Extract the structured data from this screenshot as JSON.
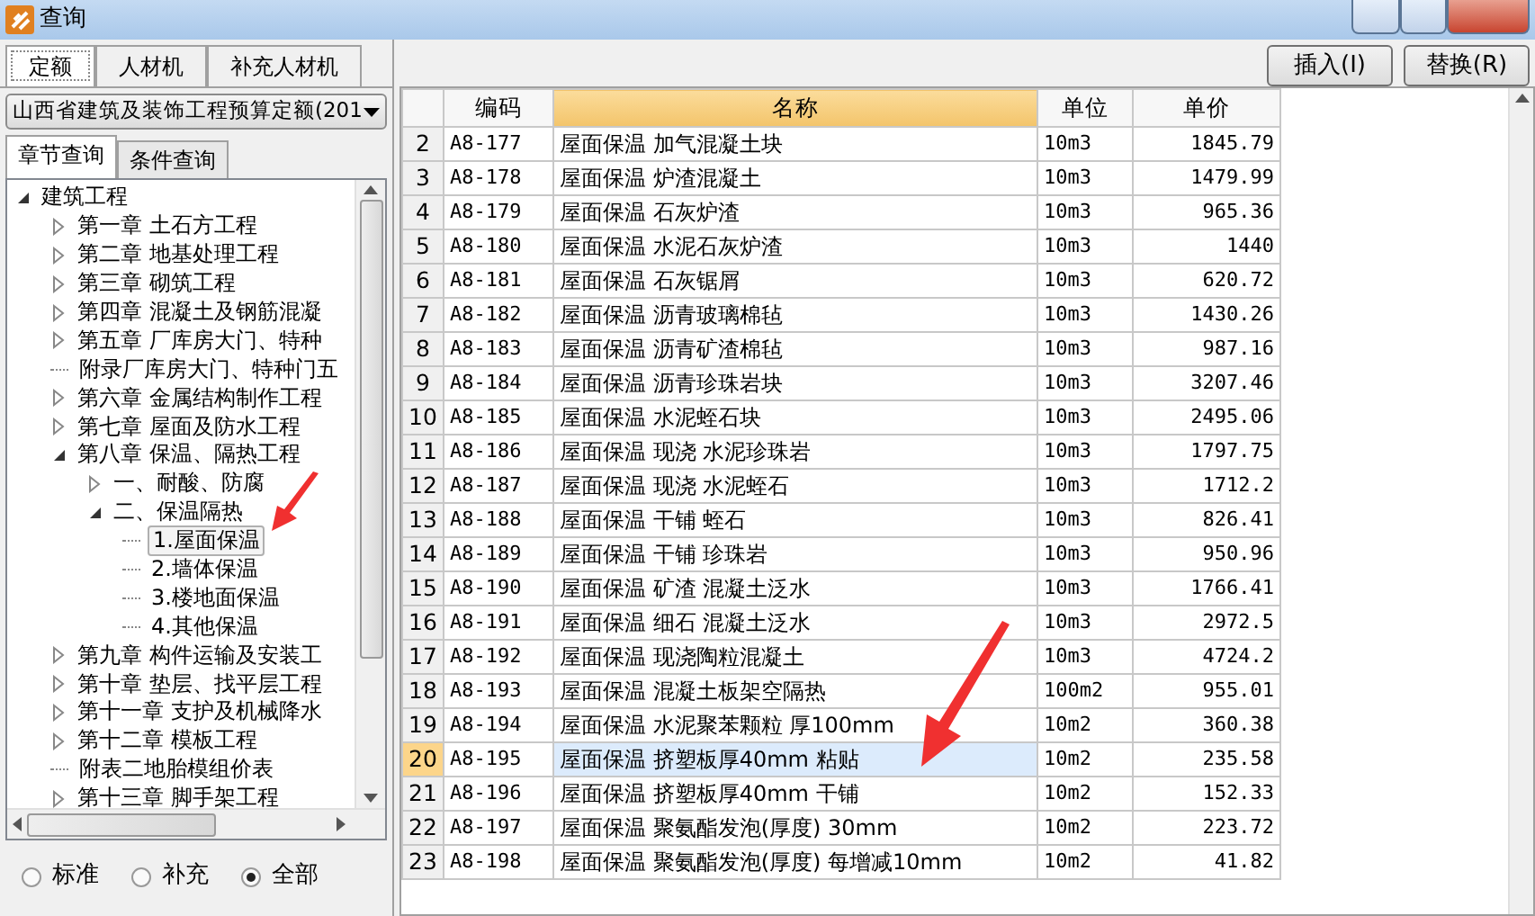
{
  "window": {
    "title": "查询"
  },
  "top_tabs": [
    {
      "label": "定额",
      "selected": true
    },
    {
      "label": "人材机",
      "selected": false
    },
    {
      "label": "补充人材机",
      "selected": false
    }
  ],
  "quota_select": {
    "value": "山西省建筑及装饰工程预算定额(201"
  },
  "query_tabs": [
    {
      "label": "章节查询",
      "selected": true
    },
    {
      "label": "条件查询",
      "selected": false
    }
  ],
  "tree": [
    {
      "label": "建筑工程",
      "expanded": true,
      "selected": false,
      "children": [
        {
          "label": "第一章 土石方工程",
          "expanded": false,
          "selected": false
        },
        {
          "label": "第二章 地基处理工程",
          "expanded": false,
          "selected": false
        },
        {
          "label": "第三章 砌筑工程",
          "expanded": false,
          "selected": false
        },
        {
          "label": "第四章 混凝土及钢筋混凝",
          "expanded": false,
          "selected": false
        },
        {
          "label": "第五章 厂库房大门、特种",
          "expanded": false,
          "selected": false
        },
        {
          "label": "附录厂库房大门、特种门五",
          "selected": false
        },
        {
          "label": "第六章 金属结构制作工程",
          "expanded": false,
          "selected": false
        },
        {
          "label": "第七章 屋面及防水工程",
          "expanded": false,
          "selected": false
        },
        {
          "label": "第八章 保温、隔热工程",
          "expanded": true,
          "selected": false,
          "children": [
            {
              "label": "一、耐酸、防腐",
              "expanded": false,
              "selected": false
            },
            {
              "label": "二、保温隔热",
              "expanded": true,
              "selected": false,
              "children": [
                {
                  "label": "1.屋面保温",
                  "selected": true
                },
                {
                  "label": "2.墙体保温",
                  "selected": false
                },
                {
                  "label": "3.楼地面保温",
                  "selected": false
                },
                {
                  "label": "4.其他保温",
                  "selected": false
                }
              ]
            }
          ]
        },
        {
          "label": "第九章 构件运输及安装工",
          "expanded": false,
          "selected": false
        },
        {
          "label": "第十章 垫层、找平层工程",
          "expanded": false,
          "selected": false
        },
        {
          "label": "第十一章 支护及机械降水",
          "expanded": false,
          "selected": false
        },
        {
          "label": "第十二章 模板工程",
          "expanded": false,
          "selected": false
        },
        {
          "label": "附表二地胎模组价表",
          "selected": false
        },
        {
          "label": "第十三章 脚手架工程",
          "expanded": false,
          "selected": false
        }
      ]
    }
  ],
  "filter": [
    {
      "label": "标准",
      "selected": false
    },
    {
      "label": "补充",
      "selected": false
    },
    {
      "label": "全部",
      "selected": true
    }
  ],
  "buttons": [
    "插入(I)",
    "替换(R)"
  ],
  "table": {
    "columns": [
      {
        "label": "编码",
        "selected": false
      },
      {
        "label": "名称",
        "selected": true
      },
      {
        "label": "单位",
        "selected": false
      },
      {
        "label": "单价",
        "selected": false
      }
    ],
    "rows": [
      {
        "no": "2",
        "code": "A8-177",
        "name": "屋面保温 加气混凝土块",
        "unit": "10m3",
        "price": "1845.79",
        "selected": false
      },
      {
        "no": "3",
        "code": "A8-178",
        "name": "屋面保温 炉渣混凝土",
        "unit": "10m3",
        "price": "1479.99",
        "selected": false
      },
      {
        "no": "4",
        "code": "A8-179",
        "name": "屋面保温 石灰炉渣",
        "unit": "10m3",
        "price": "965.36",
        "selected": false
      },
      {
        "no": "5",
        "code": "A8-180",
        "name": "屋面保温 水泥石灰炉渣",
        "unit": "10m3",
        "price": "1440",
        "selected": false
      },
      {
        "no": "6",
        "code": "A8-181",
        "name": "屋面保温 石灰锯屑",
        "unit": "10m3",
        "price": "620.72",
        "selected": false
      },
      {
        "no": "7",
        "code": "A8-182",
        "name": "屋面保温 沥青玻璃棉毡",
        "unit": "10m3",
        "price": "1430.26",
        "selected": false
      },
      {
        "no": "8",
        "code": "A8-183",
        "name": "屋面保温 沥青矿渣棉毡",
        "unit": "10m3",
        "price": "987.16",
        "selected": false
      },
      {
        "no": "9",
        "code": "A8-184",
        "name": "屋面保温 沥青珍珠岩块",
        "unit": "10m3",
        "price": "3207.46",
        "selected": false
      },
      {
        "no": "10",
        "code": "A8-185",
        "name": "屋面保温 水泥蛭石块",
        "unit": "10m3",
        "price": "2495.06",
        "selected": false
      },
      {
        "no": "11",
        "code": "A8-186",
        "name": "屋面保温 现浇 水泥珍珠岩",
        "unit": "10m3",
        "price": "1797.75",
        "selected": false
      },
      {
        "no": "12",
        "code": "A8-187",
        "name": "屋面保温 现浇 水泥蛭石",
        "unit": "10m3",
        "price": "1712.2",
        "selected": false
      },
      {
        "no": "13",
        "code": "A8-188",
        "name": "屋面保温 干铺 蛭石",
        "unit": "10m3",
        "price": "826.41",
        "selected": false
      },
      {
        "no": "14",
        "code": "A8-189",
        "name": "屋面保温 干铺 珍珠岩",
        "unit": "10m3",
        "price": "950.96",
        "selected": false
      },
      {
        "no": "15",
        "code": "A8-190",
        "name": "屋面保温 矿渣 混凝土泛水",
        "unit": "10m3",
        "price": "1766.41",
        "selected": false
      },
      {
        "no": "16",
        "code": "A8-191",
        "name": "屋面保温 细石 混凝土泛水",
        "unit": "10m3",
        "price": "2972.5",
        "selected": false
      },
      {
        "no": "17",
        "code": "A8-192",
        "name": "屋面保温 现浇陶粒混凝土",
        "unit": "10m3",
        "price": "4724.2",
        "selected": false
      },
      {
        "no": "18",
        "code": "A8-193",
        "name": "屋面保温 混凝土板架空隔热",
        "unit": "100m2",
        "price": "955.01",
        "selected": false
      },
      {
        "no": "19",
        "code": "A8-194",
        "name": "屋面保温 水泥聚苯颗粒 厚100mm",
        "unit": "10m2",
        "price": "360.38",
        "selected": false
      },
      {
        "no": "20",
        "code": "A8-195",
        "name": "屋面保温 挤塑板厚40mm 粘贴",
        "unit": "10m2",
        "price": "235.58",
        "selected": true
      },
      {
        "no": "21",
        "code": "A8-196",
        "name": "屋面保温 挤塑板厚40mm 干铺",
        "unit": "10m2",
        "price": "152.33",
        "selected": false
      },
      {
        "no": "22",
        "code": "A8-197",
        "name": "屋面保温 聚氨酯发泡(厚度) 30mm",
        "unit": "10m2",
        "price": "223.72",
        "selected": false
      },
      {
        "no": "23",
        "code": "A8-198",
        "name": "屋面保温 聚氨酯发泡(厚度) 每增减10mm",
        "unit": "10m2",
        "price": "41.82",
        "selected": false
      }
    ]
  }
}
